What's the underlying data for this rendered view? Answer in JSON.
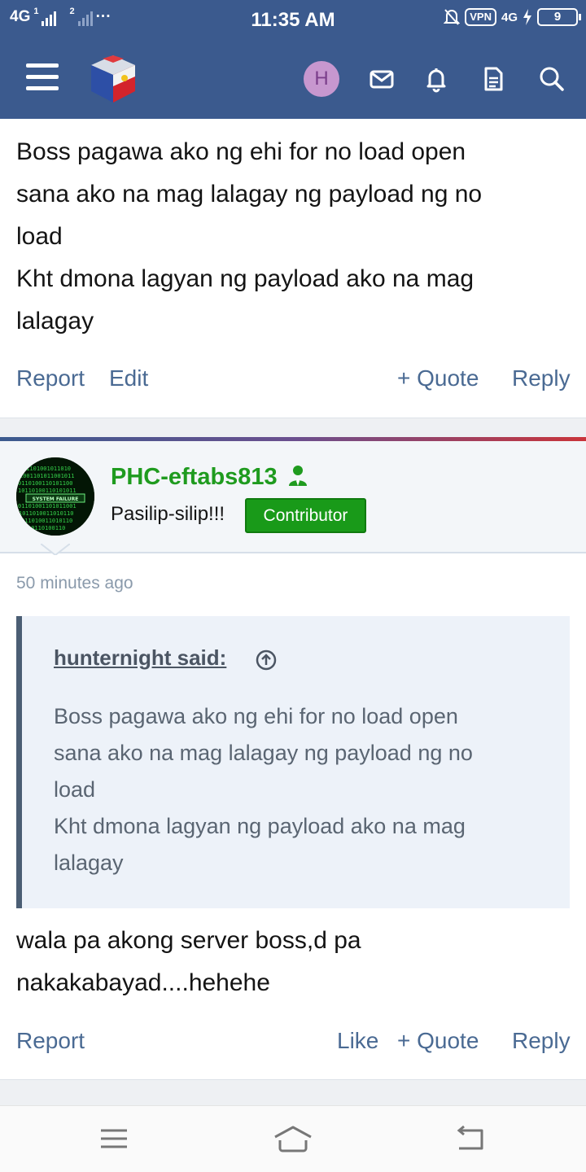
{
  "status_bar": {
    "network_1": "4G",
    "sim_1": "1",
    "sim_2": "2",
    "more": "···",
    "time": "11:35 AM",
    "vpn": "VPN",
    "network_2": "4G",
    "battery": "9"
  },
  "header": {
    "avatar_letter": "H",
    "colors": {
      "bar": "#3b5a8e",
      "avatar_bg": "#c797cf"
    }
  },
  "post_1": {
    "lines": [
      "Boss pagawa ako ng ehi for no load open",
      "sana ako na mag lalagay ng payload ng no",
      "load",
      "Kht dmona lagyan ng payload ako na mag",
      "lalagay"
    ],
    "actions": {
      "report": "Report",
      "edit": "Edit",
      "quote": "+ Quote",
      "reply": "Reply"
    }
  },
  "post_2": {
    "username": "PHC-eftabs813",
    "user_title": "Pasilip-silip!!!",
    "badge": "Contributor",
    "time_ago": "50 minutes ago",
    "avatar_text": "SYSTEM FAILURE",
    "quote": {
      "author": "hunternight said:",
      "lines": [
        "Boss pagawa ako ng ehi for no load open",
        "sana ako na mag lalagay ng payload ng no",
        "load",
        "Kht dmona lagyan ng payload ako na mag",
        "lalagay"
      ]
    },
    "body_lines": [
      "wala pa akong server boss,d pa",
      "nakakabayad....hehehe"
    ],
    "actions": {
      "report": "Report",
      "like": "Like",
      "quote": "+ Quote",
      "reply": "Reply"
    },
    "colors": {
      "username": "#1f9b1f",
      "badge": "#199a19"
    }
  }
}
